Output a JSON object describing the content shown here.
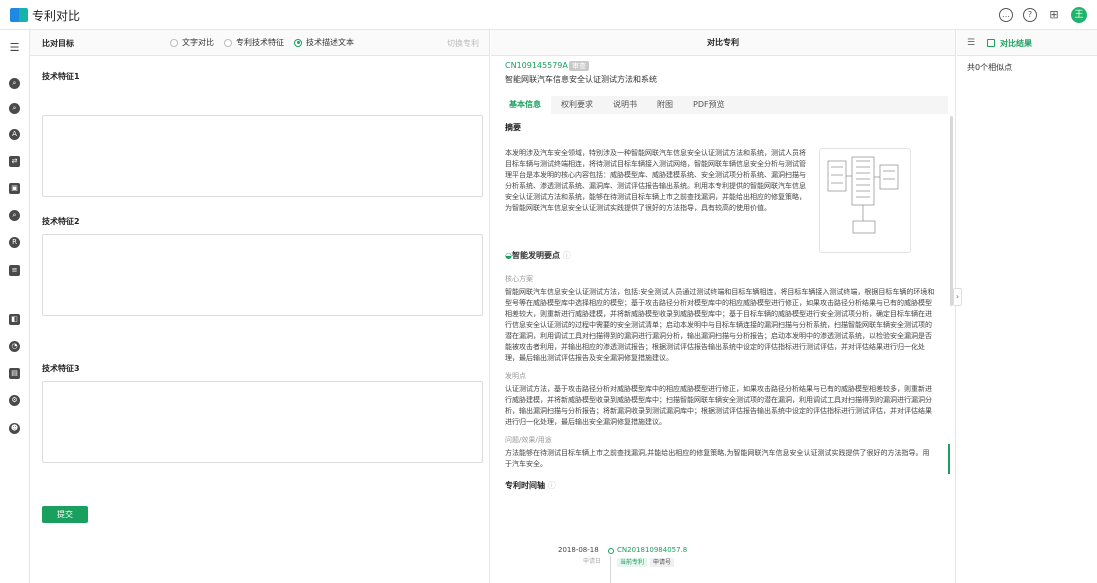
{
  "app": {
    "title": "专利对比",
    "avatar": "王"
  },
  "left": {
    "header": "比对目标",
    "radios": [
      {
        "label": "文字对比",
        "selected": false
      },
      {
        "label": "专利技术特征",
        "selected": false
      },
      {
        "label": "技术描述文本",
        "selected": true
      }
    ],
    "switch_label": "切换专利",
    "features": [
      {
        "label": "技术特征1",
        "value": ""
      },
      {
        "label": "技术特征2",
        "value": ""
      },
      {
        "label": "技术特征3",
        "value": ""
      }
    ],
    "submit_label": "提交"
  },
  "middle": {
    "header": "对比专利",
    "patent_no": "CN109145579A",
    "patent_badge": "审查",
    "patent_title": "智能网联汽车信息安全认证测试方法和系统",
    "tabs": [
      "基本信息",
      "权利要求",
      "说明书",
      "附图",
      "PDF预览"
    ],
    "active_tab": "基本信息",
    "abstract_title": "摘要",
    "abstract": "本发明涉及汽车安全领域，特别涉及一种智能网联汽车信息安全认证测试方法和系统，测试人员将目标车辆与测试终端相连，将待测试目标车辆接入测试网络，智能网联车辆信息安全分析与测试管理平台是本发明的核心内容包括：威胁模型库、威胁建模系统、安全测试项分析系统、漏洞扫描与分析系统、渗透测试系统、漏洞库、测试评估报告输出系统。利用本专利提供的智能网联汽车信息安全认证测试方法和系统，能够在待测试目标车辆上市之前查找漏洞，并能给出相应的修复策略，为智能网联汽车信息安全认证测试实践提供了很好的方法指导，具有较高的使用价值。",
    "points_title": "智能发明要点",
    "core_label": "核心方案",
    "core_text": "智能网联汽车信息安全认证测试方法，包括:安全测试人员通过测试终端和目标车辆相连，将目标车辆接入测试终端，根据目标车辆的环境和型号等在威胁模型库中选择相应的模型；基于攻击路径分析对模型库中的相应威胁模型进行修正，如果攻击路径分析结果与已有的威胁模型相差较大，则重新进行威胁建模，并将新威胁模型收录到威胁模型库中；基于目标车辆的威胁模型进行安全测试项分析，确定目标车辆在进行信息安全认证测试的过程中需要的安全测试清单；启动本发明中与目标车辆连接的漏洞扫描与分析系统，扫描智能网联车辆安全测试项的潜在漏洞，利用调试工具对扫描得到的漏洞进行漏洞分析，输出漏洞扫描与分析报告；启动本发明中的渗透测试系统，以检验安全漏洞是否能被攻击者利用，并输出相应的渗透测试报告；根据测试评估报告输出系统中设定的评估指标进行测试评估，并对评估结果进行归一化处理，最后输出测试评估报告及安全漏洞修复措施建议。",
    "invention_label": "发明点",
    "invention_text": "认证测试方法，基于攻击路径分析对威胁模型库中的相应威胁模型进行修正，如果攻击路径分析结果与已有的威胁模型相差较多，则重新进行威胁建模，并将新威胁模型收录到威胁模型库中；扫描智能网联车辆安全测试项的潜在漏洞，利用调试工具对扫描得到的漏洞进行漏洞分析，输出漏洞扫描与分析报告；将新漏洞收录到测试漏洞库中；根据测试评估报告输出系统中设定的评估指标进行测试评估，并对评估结果进行归一化处理，最后输出安全漏洞修复措施建议。",
    "effect_label": "问题/效果/用途",
    "effect_text": "方法能够在待测试目标车辆上市之前查找漏洞,并能给出相应的修复策略,为智能网联汽车信息安全认证测试实践提供了很好的方法指导。用于汽车安全。",
    "timeline_title": "专利时间轴",
    "timeline": [
      {
        "date": "2018-08-18",
        "sublabel": "申请日",
        "no": "CN201810984057.8",
        "tags": [
          "当前专利",
          "申请号"
        ]
      }
    ]
  },
  "right": {
    "tab_label": "对比结果",
    "count_text": "共0个相似点"
  }
}
